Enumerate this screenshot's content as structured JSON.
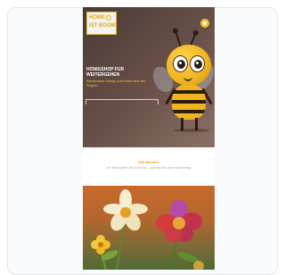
{
  "header": {
    "logo_line1": "HOME",
    "logo_line2": "IST BOOM",
    "title": "HONIGSHOP FUR WEITERGEHEN",
    "subtitle": "Besonderer Honig vom Imker aus der Region"
  },
  "info_band": {
    "title": "Gift Nachten",
    "subtitle": "Im Einkaufen bis Genuss – goodly für und nachhaltig"
  },
  "colors": {
    "accent": "#f2c531",
    "hero_bg": "#5c4740",
    "band_title": "#e2a516"
  },
  "icons": {
    "menu": "menu-icon",
    "bee": "bee-illustration",
    "flowers": "flowers-illustration"
  }
}
